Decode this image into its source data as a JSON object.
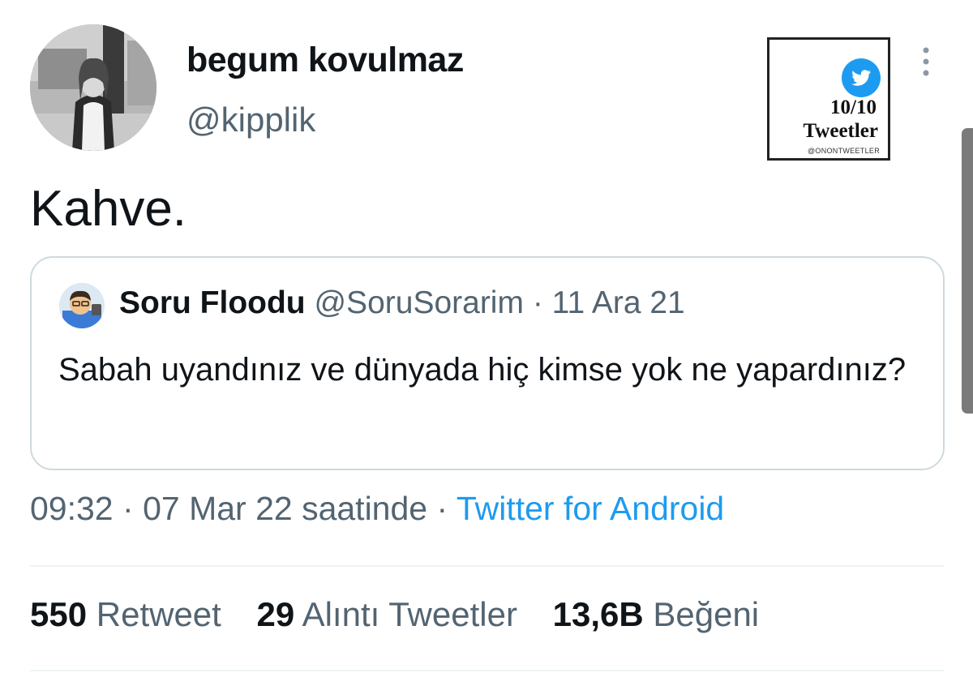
{
  "tweet": {
    "author": {
      "display_name": "begum kovulmaz",
      "handle": "@kipplik"
    },
    "text": "Kahve.",
    "quoted": {
      "display_name": "Soru Floodu",
      "handle": "@SoruSorarim",
      "separator": "·",
      "date": "11 Ara 21",
      "text": "Sabah uyandınız ve dünyada hiç kimse yok ne yapardınız?"
    },
    "meta": {
      "time": "09:32",
      "separator": "·",
      "date": "07 Mar 22 saatinde",
      "source": "Twitter for Android"
    },
    "stats": [
      {
        "count": "550",
        "label": "Retweet"
      },
      {
        "count": "29",
        "label": "Alıntı Tweetler"
      },
      {
        "count": "13,6B",
        "label": "Beğeni"
      }
    ]
  },
  "watermark": {
    "line1": "10/10",
    "line2": "Tweetler",
    "handle": "@ONONTWEETLER",
    "icon": "twitter-bird-icon"
  },
  "icons": {
    "more": "more-vertical-icon"
  },
  "colors": {
    "text_primary": "#0f1419",
    "text_secondary": "#536471",
    "link": "#1d9bf0",
    "border": "#cfd9de"
  }
}
